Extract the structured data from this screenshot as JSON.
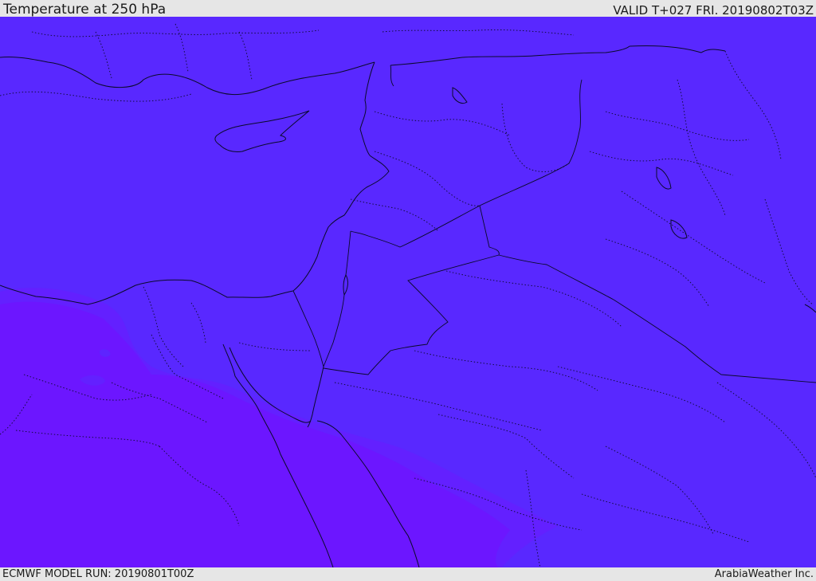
{
  "header": {
    "title": "Temperature at 250 hPa",
    "valid": "VALID T+027 FRI. 20190802T03Z"
  },
  "footer": {
    "model_run": "ECMWF MODEL RUN: 20190801T00Z",
    "credit": "ArabiaWeather Inc."
  },
  "map": {
    "field": "Temperature at 250 hPa",
    "colors": {
      "background_field": "#5928ff",
      "warm_zone": "#6c16ff",
      "transition_zone": "#6320ff",
      "lines": "#0a0a2a"
    }
  }
}
